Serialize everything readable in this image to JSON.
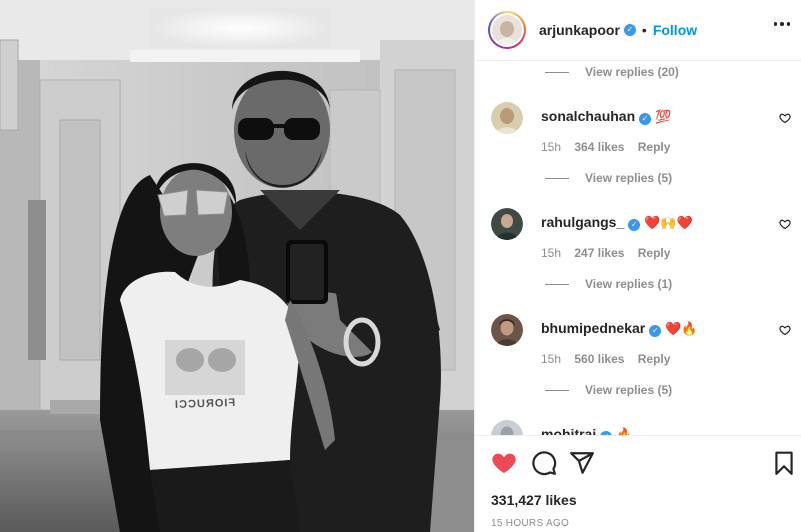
{
  "post": {
    "username": "arjunkapoor",
    "follow_label": "Follow",
    "separator": "•",
    "verified_mark": "✓",
    "likes": "331,427 likes",
    "time": "15 HOURS AGO"
  },
  "photo": {
    "shirt_text": "FIORUCCI",
    "description_icon": "mirror-selfie-photo"
  },
  "comments": {
    "replies": [
      "View replies (20)",
      "View replies (5)",
      "View replies (1)",
      "View replies (5)"
    ],
    "items": [
      {
        "user": "sonalchauhan",
        "text": "💯",
        "age": "15h",
        "likes": "364 likes",
        "reply": "Reply"
      },
      {
        "user": "rahulgangs_",
        "text": "❤️🙌❤️",
        "age": "15h",
        "likes": "247 likes",
        "reply": "Reply"
      },
      {
        "user": "bhumipednekar",
        "text": "❤️🔥",
        "age": "15h",
        "likes": "560 likes",
        "reply": "Reply"
      },
      {
        "user": "mohitrai",
        "text": "🔥",
        "age": "",
        "likes": "",
        "reply": ""
      }
    ]
  },
  "colors": {
    "like_red": "#ed4956",
    "link_blue": "#0095f6",
    "verified_blue": "#3897f0",
    "muted_gray": "#8e8e8e"
  },
  "icons": {
    "like": "heart-filled-icon",
    "comment": "comment-bubble-icon",
    "share": "paper-plane-icon",
    "save": "bookmark-icon",
    "more": "three-dots-icon",
    "comment_like": "heart-outline-icon"
  }
}
